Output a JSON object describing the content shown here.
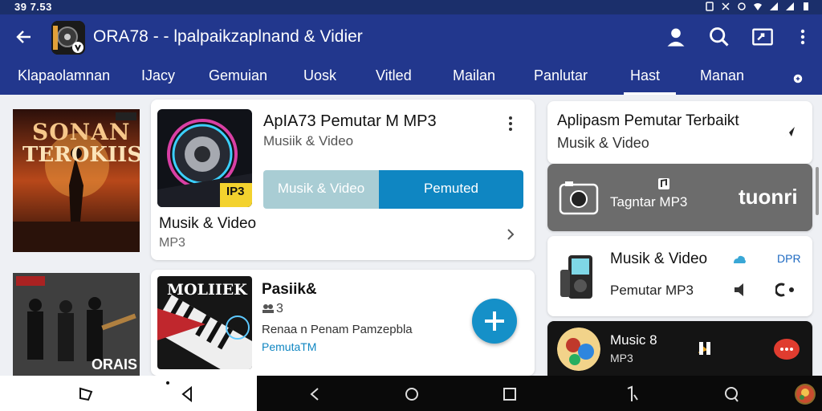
{
  "status": {
    "time": "39 7.53"
  },
  "appbar": {
    "title": "ORA78 - - lpalpaikzaplnand & Vidier",
    "tabs": [
      "Klapaolamnan",
      "IJacy",
      "Gemuian",
      "Uosk",
      "Vitled",
      "Mailan",
      "Panlutar",
      "Hast",
      "Manan"
    ],
    "active_tab": 7
  },
  "featured": {
    "title": "ApIA73 Pemutar M MP3",
    "subtitle": "Musiik & Video",
    "mp3_badge": "IP3",
    "btn_secondary": "Musik & Video",
    "btn_primary": "Pemuted",
    "footer_title": "Musik & Video",
    "footer_sub": "MP3"
  },
  "album1": {
    "line1": "SONAN",
    "line2": "TEROKIIS"
  },
  "album2": {
    "caption": "ORAIS"
  },
  "second": {
    "cover_title": "MOLIIEK",
    "title": "Pasiik&",
    "count": "3",
    "subtitle": "Renaa n Penam Pamzepbla",
    "link": "PemutaTM"
  },
  "side1": {
    "title": "Aplipasm Pemutar Terbaikt",
    "subtitle": "Musik & Video"
  },
  "side2": {
    "label": "Tagntar MP3",
    "brand": "tuonri"
  },
  "side3": {
    "title": "Musik & Video",
    "subtitle": "Pemutar MP3",
    "tag": "DPR"
  },
  "player": {
    "title": "Music 8",
    "subtitle": "MP3"
  },
  "colors": {
    "appbar": "#22378d",
    "accent": "#0f86c2",
    "fab": "#1590c8",
    "player": "#141414"
  }
}
